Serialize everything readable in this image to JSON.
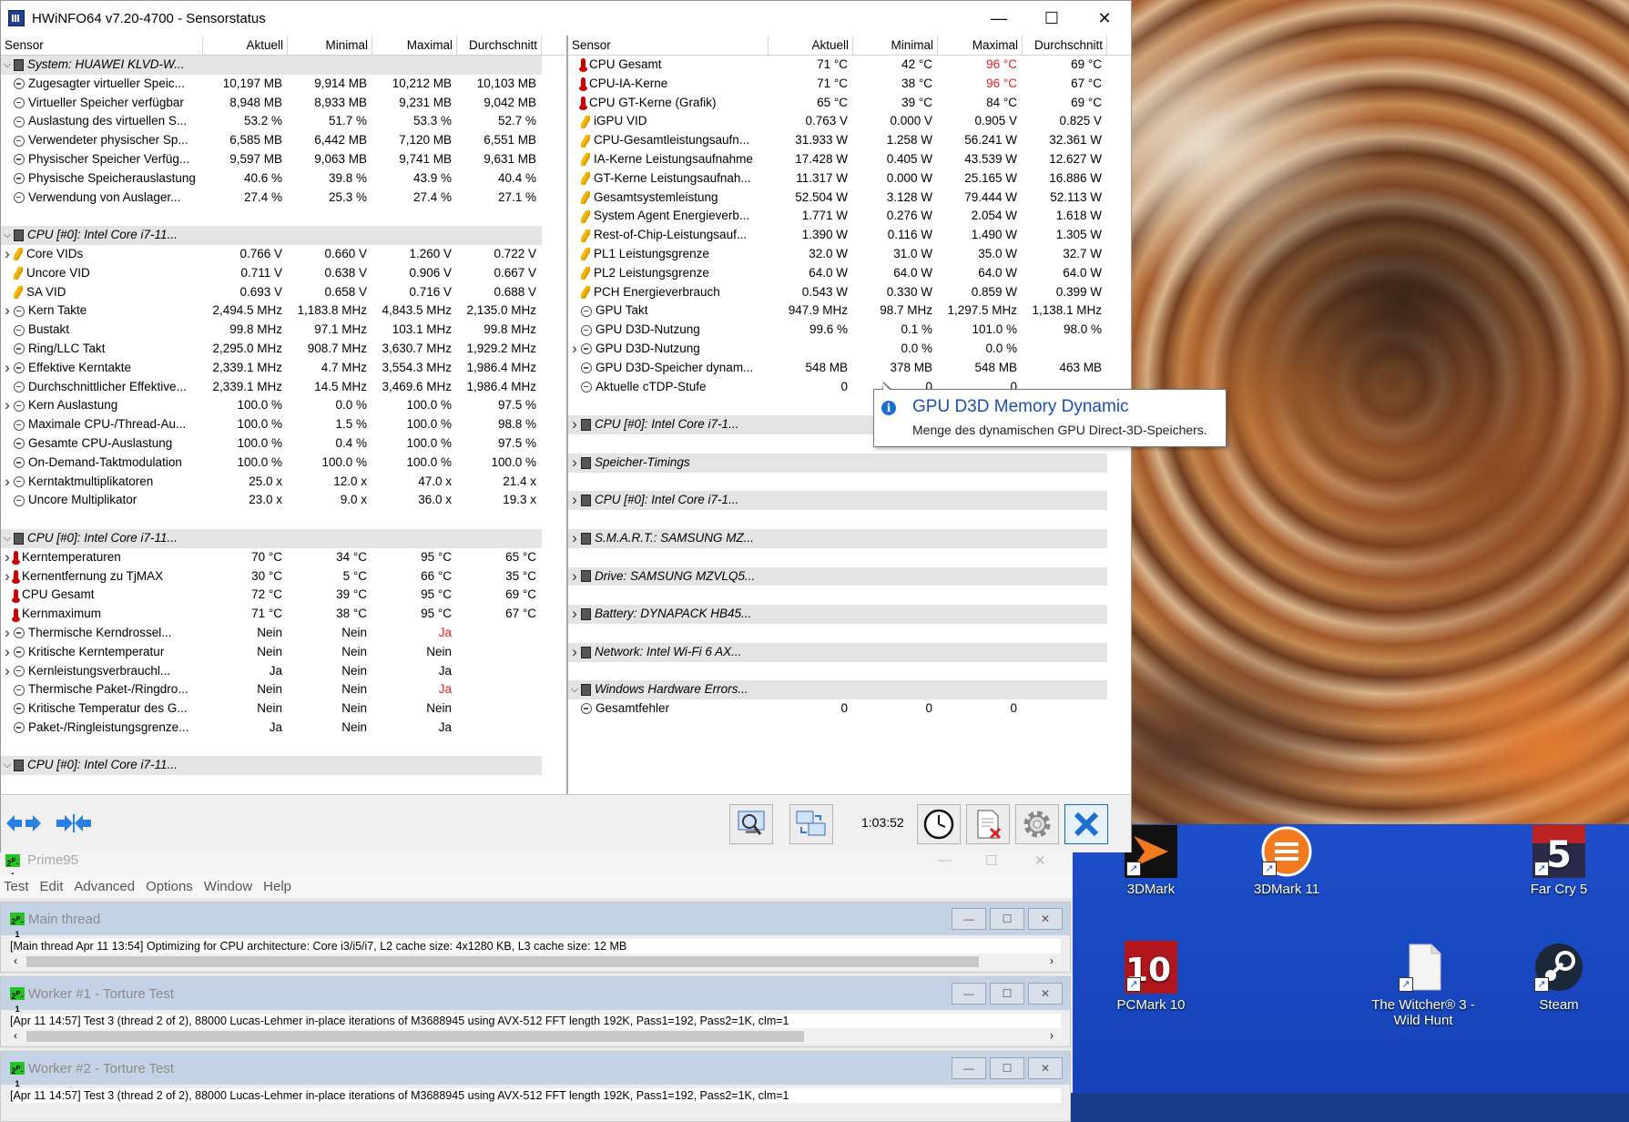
{
  "hwinfo": {
    "title": "HWiNFO64 v7.20-4700 - Sensorstatus",
    "columns": [
      "Sensor",
      "Aktuell",
      "Minimal",
      "Maximal",
      "Durchschnitt"
    ],
    "left_rows": [
      {
        "t": "group",
        "exp": "v",
        "icon": "chip",
        "label": "System: HUAWEI KLVD-W..."
      },
      {
        "t": "item",
        "exp": "",
        "icon": "clock",
        "label": "Zugesagter virtueller Speic...",
        "v": [
          "10,197 MB",
          "9,914 MB",
          "10,212 MB",
          "10,103 MB"
        ]
      },
      {
        "t": "item",
        "exp": "",
        "icon": "clock",
        "label": "Virtueller Speicher verfügbar",
        "v": [
          "8,948 MB",
          "8,933 MB",
          "9,231 MB",
          "9,042 MB"
        ]
      },
      {
        "t": "item",
        "exp": "",
        "icon": "clock",
        "label": "Auslastung des virtuellen S...",
        "v": [
          "53.2 %",
          "51.7 %",
          "53.3 %",
          "52.7 %"
        ]
      },
      {
        "t": "item",
        "exp": "",
        "icon": "clock",
        "label": "Verwendeter physischer Sp...",
        "v": [
          "6,585 MB",
          "6,442 MB",
          "7,120 MB",
          "6,551 MB"
        ]
      },
      {
        "t": "item",
        "exp": "",
        "icon": "clock",
        "label": "Physischer Speicher Verfüg...",
        "v": [
          "9,597 MB",
          "9,063 MB",
          "9,741 MB",
          "9,631 MB"
        ]
      },
      {
        "t": "item",
        "exp": "",
        "icon": "clock",
        "label": "Physische Speicherauslastung",
        "v": [
          "40.6 %",
          "39.8 %",
          "43.9 %",
          "40.4 %"
        ]
      },
      {
        "t": "item",
        "exp": "",
        "icon": "clock",
        "label": "Verwendung von Auslager...",
        "v": [
          "27.4 %",
          "25.3 %",
          "27.4 %",
          "27.1 %"
        ]
      },
      {
        "t": "blank"
      },
      {
        "t": "group",
        "exp": "v",
        "icon": "chip",
        "label": "CPU [#0]: Intel Core i7-11..."
      },
      {
        "t": "item",
        "exp": ">",
        "icon": "bolt",
        "label": "Core VIDs",
        "v": [
          "0.766 V",
          "0.660 V",
          "1.260 V",
          "0.722 V"
        ]
      },
      {
        "t": "item",
        "exp": "",
        "icon": "bolt",
        "label": "Uncore VID",
        "v": [
          "0.711 V",
          "0.638 V",
          "0.906 V",
          "0.667 V"
        ]
      },
      {
        "t": "item",
        "exp": "",
        "icon": "bolt",
        "label": "SA VID",
        "v": [
          "0.693 V",
          "0.658 V",
          "0.716 V",
          "0.688 V"
        ]
      },
      {
        "t": "item",
        "exp": ">",
        "icon": "clock",
        "label": "Kern Takte",
        "v": [
          "2,494.5 MHz",
          "1,183.8 MHz",
          "4,843.5 MHz",
          "2,135.0 MHz"
        ]
      },
      {
        "t": "item",
        "exp": "",
        "icon": "clock",
        "label": "Bustakt",
        "v": [
          "99.8 MHz",
          "97.1 MHz",
          "103.1 MHz",
          "99.8 MHz"
        ]
      },
      {
        "t": "item",
        "exp": "",
        "icon": "clock",
        "label": "Ring/LLC Takt",
        "v": [
          "2,295.0 MHz",
          "908.7 MHz",
          "3,630.7 MHz",
          "1,929.2 MHz"
        ]
      },
      {
        "t": "item",
        "exp": ">",
        "icon": "clock",
        "label": "Effektive Kerntakte",
        "v": [
          "2,339.1 MHz",
          "4.7 MHz",
          "3,554.3 MHz",
          "1,986.4 MHz"
        ]
      },
      {
        "t": "item",
        "exp": "",
        "icon": "clock",
        "label": "Durchschnittlicher Effektive...",
        "v": [
          "2,339.1 MHz",
          "14.5 MHz",
          "3,469.6 MHz",
          "1,986.4 MHz"
        ]
      },
      {
        "t": "item",
        "exp": ">",
        "icon": "clock",
        "label": "Kern Auslastung",
        "v": [
          "100.0 %",
          "0.0 %",
          "100.0 %",
          "97.5 %"
        ]
      },
      {
        "t": "item",
        "exp": "",
        "icon": "clock",
        "label": "Maximale CPU-/Thread-Au...",
        "v": [
          "100.0 %",
          "1.5 %",
          "100.0 %",
          "98.8 %"
        ]
      },
      {
        "t": "item",
        "exp": "",
        "icon": "clock",
        "label": "Gesamte CPU-Auslastung",
        "v": [
          "100.0 %",
          "0.4 %",
          "100.0 %",
          "97.5 %"
        ]
      },
      {
        "t": "item",
        "exp": "",
        "icon": "clock",
        "label": "On-Demand-Taktmodulation",
        "v": [
          "100.0 %",
          "100.0 %",
          "100.0 %",
          "100.0 %"
        ]
      },
      {
        "t": "item",
        "exp": ">",
        "icon": "clock",
        "label": "Kerntaktmultiplikatoren",
        "v": [
          "25.0 x",
          "12.0 x",
          "47.0 x",
          "21.4 x"
        ]
      },
      {
        "t": "item",
        "exp": "",
        "icon": "clock",
        "label": "Uncore Multiplikator",
        "v": [
          "23.0 x",
          "9.0 x",
          "36.0 x",
          "19.3 x"
        ]
      },
      {
        "t": "blank"
      },
      {
        "t": "group",
        "exp": "v",
        "icon": "chip",
        "label": "CPU [#0]: Intel Core i7-11..."
      },
      {
        "t": "item",
        "exp": ">",
        "icon": "therm",
        "label": "Kerntemperaturen",
        "v": [
          "70 °C",
          "34 °C",
          "95 °C",
          "65 °C"
        ]
      },
      {
        "t": "item",
        "exp": ">",
        "icon": "therm",
        "label": "Kernentfernung zu TjMAX",
        "v": [
          "30 °C",
          "5 °C",
          "66 °C",
          "35 °C"
        ]
      },
      {
        "t": "item",
        "exp": "",
        "icon": "therm",
        "label": "CPU Gesamt",
        "v": [
          "72 °C",
          "39 °C",
          "95 °C",
          "69 °C"
        ]
      },
      {
        "t": "item",
        "exp": "",
        "icon": "therm",
        "label": "Kernmaximum",
        "v": [
          "71 °C",
          "38 °C",
          "95 °C",
          "67 °C"
        ]
      },
      {
        "t": "item",
        "exp": ">",
        "icon": "clock",
        "label": "Thermische Kerndrossel...",
        "v": [
          "Nein",
          "Nein",
          "Ja",
          ""
        ],
        "red": [
          2
        ]
      },
      {
        "t": "item",
        "exp": ">",
        "icon": "clock",
        "label": "Kritische Kerntemperatur",
        "v": [
          "Nein",
          "Nein",
          "Nein",
          ""
        ]
      },
      {
        "t": "item",
        "exp": ">",
        "icon": "clock",
        "label": "Kernleistungsverbrauchl...",
        "v": [
          "Ja",
          "Nein",
          "Ja",
          ""
        ]
      },
      {
        "t": "item",
        "exp": "",
        "icon": "clock",
        "label": "Thermische Paket-/Ringdro...",
        "v": [
          "Nein",
          "Nein",
          "Ja",
          ""
        ],
        "red": [
          2
        ]
      },
      {
        "t": "item",
        "exp": "",
        "icon": "clock",
        "label": "Kritische Temperatur des G...",
        "v": [
          "Nein",
          "Nein",
          "Nein",
          ""
        ]
      },
      {
        "t": "item",
        "exp": "",
        "icon": "clock",
        "label": "Paket-/Ringleistungsgrenze...",
        "v": [
          "Ja",
          "Nein",
          "Ja",
          ""
        ]
      },
      {
        "t": "blank"
      },
      {
        "t": "group",
        "exp": "v",
        "icon": "chip",
        "label": "CPU [#0]: Intel Core i7-11..."
      }
    ],
    "right_rows": [
      {
        "t": "item",
        "exp": "",
        "icon": "therm",
        "label": "CPU Gesamt",
        "v": [
          "71 °C",
          "42 °C",
          "96 °C",
          "69 °C"
        ],
        "red": [
          2
        ]
      },
      {
        "t": "item",
        "exp": "",
        "icon": "therm",
        "label": "CPU-IA-Kerne",
        "v": [
          "71 °C",
          "38 °C",
          "96 °C",
          "67 °C"
        ],
        "red": [
          2
        ]
      },
      {
        "t": "item",
        "exp": "",
        "icon": "therm",
        "label": "CPU GT-Kerne (Grafik)",
        "v": [
          "65 °C",
          "39 °C",
          "84 °C",
          "69 °C"
        ]
      },
      {
        "t": "item",
        "exp": "",
        "icon": "bolt",
        "label": "iGPU VID",
        "v": [
          "0.763 V",
          "0.000 V",
          "0.905 V",
          "0.825 V"
        ]
      },
      {
        "t": "item",
        "exp": "",
        "icon": "bolt",
        "label": "CPU-Gesamtleistungsaufn...",
        "v": [
          "31.933 W",
          "1.258 W",
          "56.241 W",
          "32.361 W"
        ]
      },
      {
        "t": "item",
        "exp": "",
        "icon": "bolt",
        "label": "IA-Kerne Leistungsaufnahme",
        "v": [
          "17.428 W",
          "0.405 W",
          "43.539 W",
          "12.627 W"
        ]
      },
      {
        "t": "item",
        "exp": "",
        "icon": "bolt",
        "label": "GT-Kerne Leistungsaufnah...",
        "v": [
          "11.317 W",
          "0.000 W",
          "25.165 W",
          "16.886 W"
        ]
      },
      {
        "t": "item",
        "exp": "",
        "icon": "bolt",
        "label": "Gesamtsystemleistung",
        "v": [
          "52.504 W",
          "3.128 W",
          "79.444 W",
          "52.113 W"
        ]
      },
      {
        "t": "item",
        "exp": "",
        "icon": "bolt",
        "label": "System Agent Energieverb...",
        "v": [
          "1.771 W",
          "0.276 W",
          "2.054 W",
          "1.618 W"
        ]
      },
      {
        "t": "item",
        "exp": "",
        "icon": "bolt",
        "label": "Rest-of-Chip-Leistungsauf...",
        "v": [
          "1.390 W",
          "0.116 W",
          "1.490 W",
          "1.305 W"
        ]
      },
      {
        "t": "item",
        "exp": "",
        "icon": "bolt",
        "label": "PL1 Leistungsgrenze",
        "v": [
          "32.0 W",
          "31.0 W",
          "35.0 W",
          "32.7 W"
        ]
      },
      {
        "t": "item",
        "exp": "",
        "icon": "bolt",
        "label": "PL2 Leistungsgrenze",
        "v": [
          "64.0 W",
          "64.0 W",
          "64.0 W",
          "64.0 W"
        ]
      },
      {
        "t": "item",
        "exp": "",
        "icon": "bolt",
        "label": "PCH Energieverbrauch",
        "v": [
          "0.543 W",
          "0.330 W",
          "0.859 W",
          "0.399 W"
        ]
      },
      {
        "t": "item",
        "exp": "",
        "icon": "clock",
        "label": "GPU Takt",
        "v": [
          "947.9 MHz",
          "98.7 MHz",
          "1,297.5 MHz",
          "1,138.1 MHz"
        ]
      },
      {
        "t": "item",
        "exp": "",
        "icon": "clock",
        "label": "GPU D3D-Nutzung",
        "v": [
          "99.6 %",
          "0.1 %",
          "101.0 %",
          "98.0 %"
        ]
      },
      {
        "t": "item",
        "exp": ">",
        "icon": "clock",
        "label": "GPU D3D-Nutzung",
        "v": [
          "",
          "0.0 %",
          "0.0 %",
          ""
        ]
      },
      {
        "t": "item",
        "exp": "",
        "icon": "clock",
        "label": "GPU D3D-Speicher dynam...",
        "v": [
          "548 MB",
          "378 MB",
          "548 MB",
          "463 MB"
        ]
      },
      {
        "t": "item",
        "exp": "",
        "icon": "clock",
        "label": "Aktuelle cTDP-Stufe",
        "v": [
          "0",
          "0",
          "0",
          ""
        ]
      },
      {
        "t": "blank"
      },
      {
        "t": "group",
        "exp": ">",
        "icon": "chip",
        "label": "CPU [#0]: Intel Core i7-1..."
      },
      {
        "t": "blank"
      },
      {
        "t": "group",
        "exp": ">",
        "icon": "chip",
        "label": "Speicher-Timings"
      },
      {
        "t": "blank"
      },
      {
        "t": "group",
        "exp": ">",
        "icon": "chip",
        "label": "CPU [#0]: Intel Core i7-1..."
      },
      {
        "t": "blank"
      },
      {
        "t": "group",
        "exp": ">",
        "icon": "chip",
        "label": "S.M.A.R.T.: SAMSUNG MZ..."
      },
      {
        "t": "blank"
      },
      {
        "t": "group",
        "exp": ">",
        "icon": "chip",
        "label": "Drive: SAMSUNG MZVLQ5..."
      },
      {
        "t": "blank"
      },
      {
        "t": "group",
        "exp": ">",
        "icon": "chip",
        "label": "Battery: DYNAPACK HB45..."
      },
      {
        "t": "blank"
      },
      {
        "t": "group",
        "exp": ">",
        "icon": "chip",
        "label": "Network: Intel Wi-Fi 6 AX..."
      },
      {
        "t": "blank"
      },
      {
        "t": "group",
        "exp": "v",
        "icon": "chip",
        "label": "Windows Hardware Errors..."
      },
      {
        "t": "item",
        "exp": "",
        "icon": "clock",
        "label": "Gesamtfehler",
        "v": [
          "0",
          "0",
          "0",
          ""
        ]
      }
    ],
    "timer": "1:03:52",
    "tooltip": {
      "title": "GPU D3D Memory Dynamic",
      "desc": "Menge des dynamischen GPU Direct-3D-Speichers."
    }
  },
  "prime95": {
    "title": "Prime95",
    "menu": [
      "Test",
      "Edit",
      "Advanced",
      "Options",
      "Window",
      "Help"
    ],
    "windows": [
      {
        "title": "Main thread",
        "text": "[Main thread Apr 11 13:54] Optimizing for CPU architecture: Core i3/i5/i7, L2 cache size: 4x1280 KB, L3 cache size: 12 MB"
      },
      {
        "title": "Worker #1 - Torture Test",
        "text": "[Apr 11 14:57] Test 3 (thread 2 of 2), 88000 Lucas-Lehmer in-place iterations of M3688945 using AVX-512 FFT length 192K, Pass1=192, Pass2=1K, clm=1"
      },
      {
        "title": "Worker #2 - Torture Test",
        "text": "[Apr 11 14:57] Test 3 (thread 2 of 2), 88000 Lucas-Lehmer in-place iterations of M3688945 using AVX-512 FFT length 192K, Pass1=192, Pass2=1K, clm=1"
      }
    ]
  },
  "desktop": {
    "icons": [
      {
        "name": "3DMark",
        "icon": "3dmark-icon"
      },
      {
        "name": "3DMark 11",
        "icon": "3dmark11-icon"
      },
      {
        "name": "Far Cry 5",
        "icon": "farcry5-icon"
      },
      {
        "name": "PCMark 10",
        "icon": "pcmark10-icon"
      },
      {
        "name": "The Witcher® 3 - Wild Hunt",
        "icon": "file-icon"
      },
      {
        "name": "Steam",
        "icon": "steam-icon"
      }
    ]
  }
}
